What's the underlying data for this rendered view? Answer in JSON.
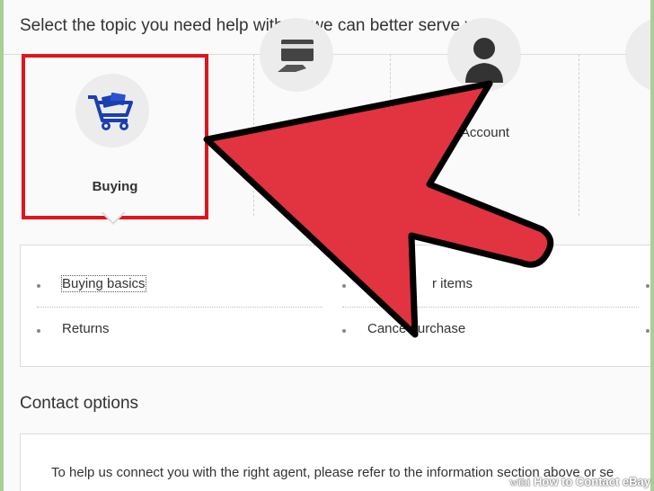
{
  "heading": "Select the topic you need help with so we can better serve you",
  "tiles": [
    {
      "label": "Buying",
      "icon": "shopping-cart-icon",
      "selected": true
    },
    {
      "label": "",
      "icon": "credit-card-icon",
      "selected": false
    },
    {
      "label": "Account",
      "icon": "user-icon",
      "selected": false
    }
  ],
  "topics": {
    "left": [
      "Buying basics",
      "Returns"
    ],
    "right": [
      "r items",
      "Cance  purchase"
    ]
  },
  "contact": {
    "heading": "Contact options",
    "text": "To help us connect you with the right agent, please refer to the information section above or se"
  },
  "watermark": {
    "wiki": "wiki",
    "title": "How to Contact eBay"
  },
  "colors": {
    "highlight_border": "#e0141b",
    "arrow_fill": "#e23340",
    "cart_blue": "#1a3fb0",
    "frame_green": "#a9cf95"
  }
}
